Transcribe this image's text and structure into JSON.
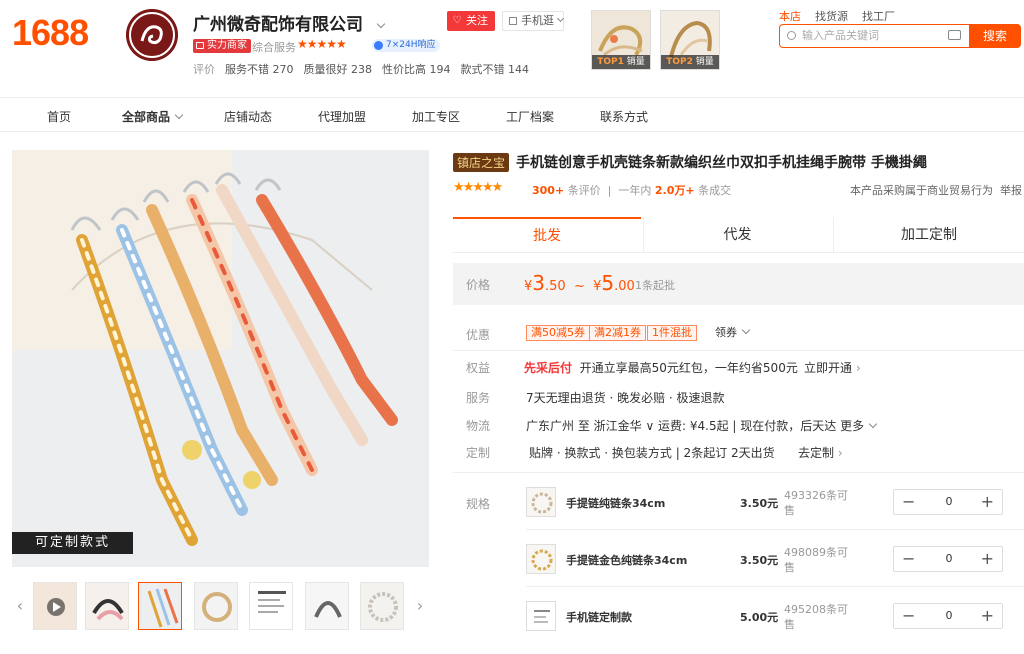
{
  "header": {
    "logo": "1688",
    "shop_name": "广州微奇配饰有限公司",
    "power_badge": "实力商家",
    "service_label": "综合服务",
    "service_stars": "★★★★★",
    "support_badge": "7×24H响应",
    "ratings_label": "评价",
    "ratings": [
      {
        "label": "服务不错",
        "count": "270"
      },
      {
        "label": "质量很好",
        "count": "238"
      },
      {
        "label": "性价比高",
        "count": "194"
      },
      {
        "label": "款式不错",
        "count": "144"
      }
    ],
    "follow_label": "关注",
    "mobile_label": "手机逛",
    "top_products": [
      {
        "tag_rank": "TOP1",
        "tag_text": "销量"
      },
      {
        "tag_rank": "TOP2",
        "tag_text": "销量"
      }
    ],
    "search_tabs": [
      "本店",
      "找货源",
      "找工厂"
    ],
    "search_placeholder": "输入产品关键词",
    "search_button": "搜索"
  },
  "nav": [
    "首页",
    "全部商品",
    "店铺动态",
    "代理加盟",
    "加工专区",
    "工厂档案",
    "联系方式"
  ],
  "gallery": {
    "custom_label": "可定制款式",
    "thumb_count": 8
  },
  "product": {
    "tag": "镇店之宝",
    "title": "手机链创意手机壳链条新款编织丝巾双扣手机挂绳手腕带 手機掛繩",
    "stars": "★★★★★",
    "reviews_count": "300+",
    "reviews_label": "条评价",
    "sales_prefix": "一年内",
    "sales_count": "2.0万+",
    "sales_label": "条成交",
    "note": "本产品采购属于商业贸易行为",
    "report": "举报",
    "tabs": [
      "批发",
      "代发",
      "加工定制"
    ],
    "price_label": "价格",
    "price_min_int": "3",
    "price_min_dec": ".50",
    "price_max_int": "5",
    "price_max_dec": ".00",
    "currency": "¥",
    "price_sep": "~",
    "moq": "1条起批",
    "discount_label": "优惠",
    "coupons": [
      "满50减5券",
      "满2减1券",
      "1件混批"
    ],
    "coupon_more": "领券",
    "benefit_label": "权益",
    "benefit_highlight": "先采后付",
    "benefit_text": "开通立享最高50元红包，一年约省500元",
    "benefit_action": "立即开通",
    "service_label": "服务",
    "service_text": "7天无理由退货 · 晚发必赔 · 极速退款",
    "logistics_label": "物流",
    "logistics_text": "广东广州 至 浙江金华 ∨  运费: ¥4.5起 | 现在付款，后天达 更多",
    "custom_label": "定制",
    "custom_text": "贴牌 · 换款式 · 换包装方式  |  2条起订  2天出货",
    "custom_action": "去定制",
    "spec_label": "规格",
    "skus": [
      {
        "name": "手提链纯链条34cm",
        "price": "3.50元",
        "stock": "493326条可售",
        "qty": "0"
      },
      {
        "name": "手提链金色纯链条34cm",
        "price": "3.50元",
        "stock": "498089条可售",
        "qty": "0"
      },
      {
        "name": "手机链定制款",
        "price": "5.00元",
        "stock": "495208条可售",
        "qty": "0"
      }
    ]
  },
  "colors": {
    "accent": "#ff5000",
    "red": "#f23838",
    "tag_bg": "#6b3a12"
  }
}
